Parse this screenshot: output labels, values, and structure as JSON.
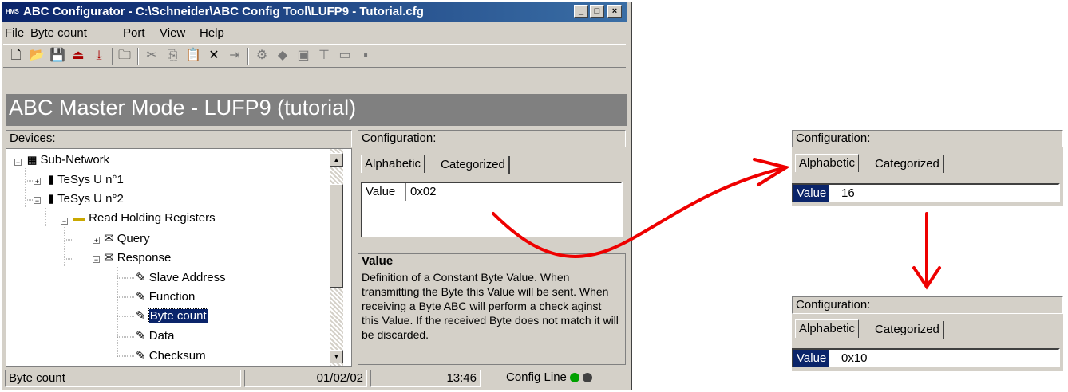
{
  "window": {
    "app_icon_text": "HMS",
    "title": "ABC Configurator - C:\\Schneider\\ABC Config Tool\\LUFP9 - Tutorial.cfg",
    "caption_buttons": [
      "_",
      "□",
      "×"
    ]
  },
  "menu": [
    "File",
    "Byte count",
    "Port",
    "View",
    "Help"
  ],
  "toolbar_icons": [
    "new-icon",
    "open-icon",
    "save-icon",
    "upload-icon",
    "download-icon",
    "up-folder-icon",
    "cut-icon",
    "copy-icon",
    "paste-icon",
    "delete-icon",
    "insert-icon",
    "properties-icon",
    "node-icon",
    "monitor-icon",
    "network-icon",
    "display-icon",
    "connector-icon"
  ],
  "mode_title": "ABC Master Mode - LUFP9 (tutorial)",
  "devices": {
    "header": "Devices:",
    "tree": [
      {
        "label": "Sub-Network",
        "level": 0,
        "expander": "-",
        "icon": "network-icon"
      },
      {
        "label": "TeSys U n°1",
        "level": 1,
        "expander": "+",
        "icon": "device-icon"
      },
      {
        "label": "TeSys U n°2",
        "level": 1,
        "expander": "-",
        "icon": "device-icon"
      },
      {
        "label": "Read Holding Registers",
        "level": 2,
        "expander": "-",
        "icon": "folder-icon"
      },
      {
        "label": "Query",
        "level": 3,
        "expander": "+",
        "icon": "envelope-icon"
      },
      {
        "label": "Response",
        "level": 3,
        "expander": "-",
        "icon": "envelope-icon"
      },
      {
        "label": "Slave Address",
        "level": 4,
        "expander": "",
        "icon": "edit-icon"
      },
      {
        "label": "Function",
        "level": 4,
        "expander": "",
        "icon": "edit-icon"
      },
      {
        "label": "Byte count",
        "level": 4,
        "expander": "",
        "icon": "edit-icon",
        "selected": true
      },
      {
        "label": "Data",
        "level": 4,
        "expander": "",
        "icon": "edit-icon"
      },
      {
        "label": "Checksum",
        "level": 4,
        "expander": "",
        "icon": "edit-icon"
      }
    ]
  },
  "config": {
    "header": "Configuration:",
    "tabs": [
      "Alphabetic",
      "Categorized"
    ],
    "value_label": "Value",
    "value": "0x02"
  },
  "description": {
    "title": "Value",
    "text": "Definition of a Constant Byte Value. When transmitting the Byte this Value will be sent. When receiving a Byte ABC will perform a check aginst this Value. If the received Byte does not match it will be discarded."
  },
  "status": {
    "item": "Byte count",
    "date": "01/02/02",
    "time": "13:46",
    "config_line": "Config Line",
    "led_colors": [
      "#00a000",
      "#404040"
    ]
  },
  "panel_edit": {
    "header": "Configuration:",
    "tabs": [
      "Alphabetic",
      "Categorized"
    ],
    "value_label": "Value",
    "value": "16"
  },
  "panel_result": {
    "header": "Configuration:",
    "tabs": [
      "Alphabetic",
      "Categorized"
    ],
    "value_label": "Value",
    "value": "0x10"
  },
  "arrow_color": "#ee0000"
}
